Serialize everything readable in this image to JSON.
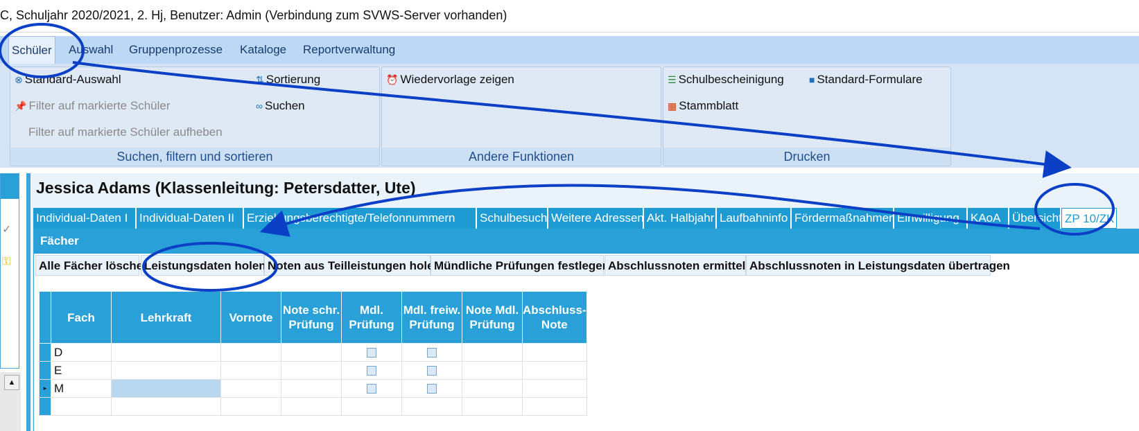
{
  "titlebar": {
    "text": "C, Schuljahr 2020/2021, 2. Hj, Benutzer: Admin (Verbindung zum SVWS-Server vorhanden)"
  },
  "menu": {
    "tabs": [
      {
        "label": "Schüler"
      },
      {
        "label": "Auswahl"
      },
      {
        "label": "Gruppenprozesse"
      },
      {
        "label": "Kataloge"
      },
      {
        "label": "Reportverwaltung"
      }
    ]
  },
  "ribbon": {
    "search_group": {
      "caption": "Suchen, filtern und sortieren",
      "standard_selection": "Standard-Auswahl",
      "filter_marked": "Filter auf markierte Schüler",
      "filter_remove": "Filter auf markierte Schüler aufheben",
      "sort": "Sortierung",
      "search": "Suchen"
    },
    "other_group": {
      "caption": "Andere Funktionen",
      "resubmission": "Wiedervorlage zeigen"
    },
    "print_group": {
      "caption": "Drucken",
      "certificate": "Schulbescheinigung",
      "forms": "Standard-Formulare",
      "master_sheet": "Stammblatt"
    }
  },
  "student": {
    "title": "Jessica Adams (Klassenleitung: Petersdatter, Ute)"
  },
  "detail_tabs": [
    {
      "label": "Individual-Daten I"
    },
    {
      "label": "Individual-Daten II"
    },
    {
      "label": "Erziehungsberechtigte/Telefonnummern"
    },
    {
      "label": "Schulbesuch"
    },
    {
      "label": "Weitere Adressen"
    },
    {
      "label": "Akt. Halbjahr"
    },
    {
      "label": "Laufbahninfo"
    },
    {
      "label": "Fördermaßnahmen"
    },
    {
      "label": "Einwilligung"
    },
    {
      "label": "KAoA"
    },
    {
      "label": "Übersicht"
    },
    {
      "label": "ZP 10/ZK"
    }
  ],
  "panel": {
    "header": "Fächer",
    "buttons": [
      {
        "label": "Alle Fächer löschen"
      },
      {
        "label": "Leistungsdaten holen"
      },
      {
        "label": "Noten aus Teilleistungen holen"
      },
      {
        "label": "Mündliche Prüfungen festlegen"
      },
      {
        "label": "Abschlussnoten ermitteln"
      },
      {
        "label": "Abschlussnoten in Leistungsdaten übertragen"
      }
    ],
    "columns": [
      {
        "label": "Fach"
      },
      {
        "label": "Lehrkraft"
      },
      {
        "label": "Vornote"
      },
      {
        "label": "Note schr. Prüfung"
      },
      {
        "label": "Mdl. Prüfung"
      },
      {
        "label": "Mdl. freiw. Prüfung"
      },
      {
        "label": "Note Mdl. Prüfung"
      },
      {
        "label": "Abschluss-Note"
      }
    ],
    "rows": [
      {
        "fach": "D",
        "teacher": "",
        "current": false
      },
      {
        "fach": "E",
        "teacher": "",
        "current": false
      },
      {
        "fach": "M",
        "teacher": "",
        "current": true
      }
    ]
  },
  "colors": {
    "accent": "#2aa0d8",
    "annotation": "#0a3fc6",
    "ribbon": "#d4e4f5"
  }
}
